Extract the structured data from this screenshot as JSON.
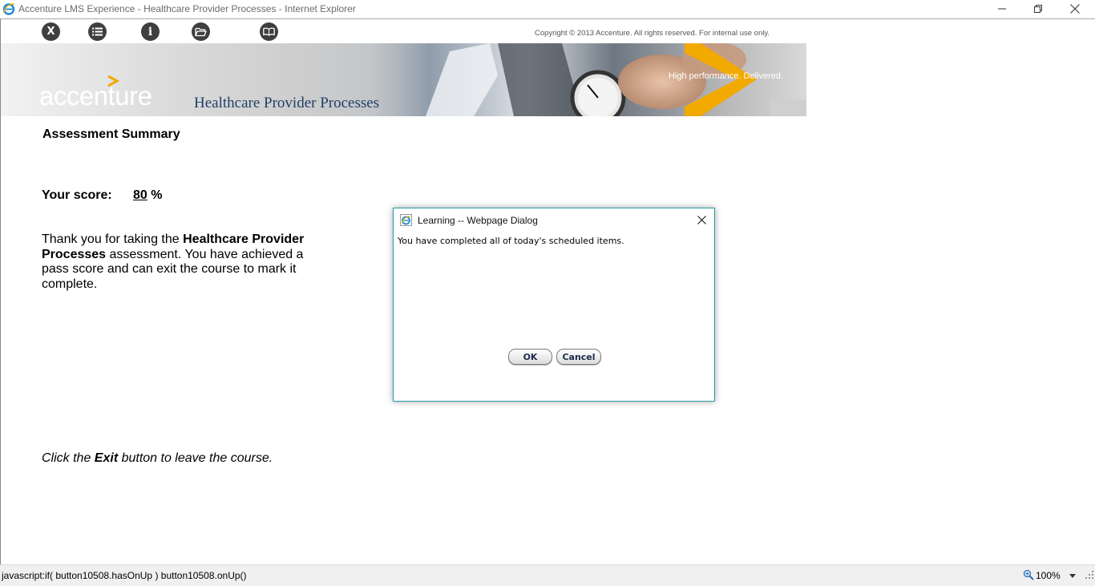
{
  "window": {
    "title": "Accenture LMS Experience - Healthcare Provider Processes - Internet Explorer",
    "icon": "ie-icon",
    "controls": [
      "minimize-icon",
      "restore-icon",
      "close-icon"
    ]
  },
  "toolbar": {
    "exit_label": "X",
    "info_label": "i",
    "buttons": [
      "exit-button",
      "menu-button",
      "info-button",
      "folder-button",
      "glossary-button"
    ],
    "copyright": "Copyright © 2013 Accenture. All rights reserved.  For internal use only."
  },
  "banner": {
    "logo": "accenture",
    "course_title": "Healthcare Provider Processes",
    "tagline": "High performance. Delivered.",
    "accent_color": "#f2a900"
  },
  "content": {
    "heading": "Assessment Summary",
    "score_label": "Your score:",
    "score_value": "80",
    "score_unit": "%",
    "thanks_prefix": "Thank you for taking the ",
    "thanks_bold": "Healthcare Provider Processes",
    "thanks_suffix": " assessment. You have achieved a pass score and can exit the course to mark it complete.",
    "click_prefix": "Click the ",
    "click_bold": "Exit",
    "click_suffix": " button to leave the course."
  },
  "dialog": {
    "title": "Learning -- Webpage Dialog",
    "message": "You have completed all of today's scheduled items.",
    "ok_label": "OK",
    "cancel_label": "Cancel"
  },
  "statusbar": {
    "text": "javascript:if( button10508.hasOnUp ) button10508.onUp()",
    "zoom": "100%"
  }
}
